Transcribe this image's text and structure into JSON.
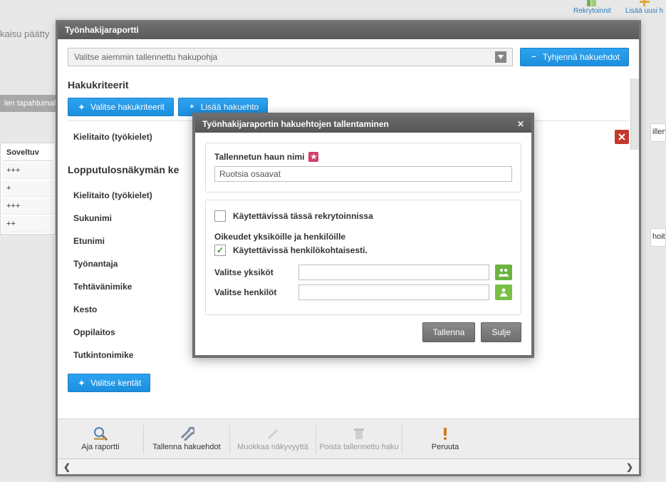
{
  "top_strip": {
    "recruitments": "Rekrytoinnit",
    "add_new": "Lisää uusi h"
  },
  "bg": {
    "left_text": "kaisu päätty",
    "tab": "len tapahtumal",
    "table_header": "Soveltuv",
    "rows": [
      "+++",
      "+",
      "+++",
      "++"
    ],
    "right_sliver": "illen",
    "right_sliver2": "hoitaj"
  },
  "outer": {
    "title": "Työnhakijaraportti",
    "saved_select_placeholder": "Valitse aiemmin tallennettu hakupohja",
    "clear_btn": "Tyhjennä hakuehdot",
    "criteria_hdr": "Hakukriteerit",
    "choose_criteria_btn": "Valitse hakukriteerit",
    "add_condition_btn": "Lisää hakuehto",
    "criteria_label": "Kielitaito (työkielet)",
    "output_hdr": "Lopputulosnäkymän ke",
    "fields": [
      "Kielitaito (työkielet)",
      "Sukunimi",
      "Etunimi",
      "Työnantaja",
      "Tehtävänimike",
      "Kesto",
      "Oppilaitos",
      "Tutkintonimike"
    ],
    "choose_fields_btn": "Valitse kentät",
    "toolbar": {
      "run": "Aja raportti",
      "save": "Tallenna hakuehdot",
      "edit": "Muokkaa näkyvyyttä",
      "delete": "Poista tallennettu haku",
      "cancel": "Peruuta"
    }
  },
  "inner": {
    "title": "Työnhakijaraportin hakuehtojen tallentaminen",
    "name_label": "Tallennetun haun nimi",
    "name_value": "Ruotsia osaavat",
    "use_in_recruitment": "Käytettävissä tässä rekrytoinnissa",
    "rights_hdr": "Oikeudet yksiköille ja henkilöille",
    "personal_label": "Käytettävissä henkilökohtaisesti.",
    "choose_units": "Valitse yksiköt",
    "choose_people": "Valitse henkilöt",
    "save_btn": "Tallenna",
    "close_btn": "Sulje"
  }
}
